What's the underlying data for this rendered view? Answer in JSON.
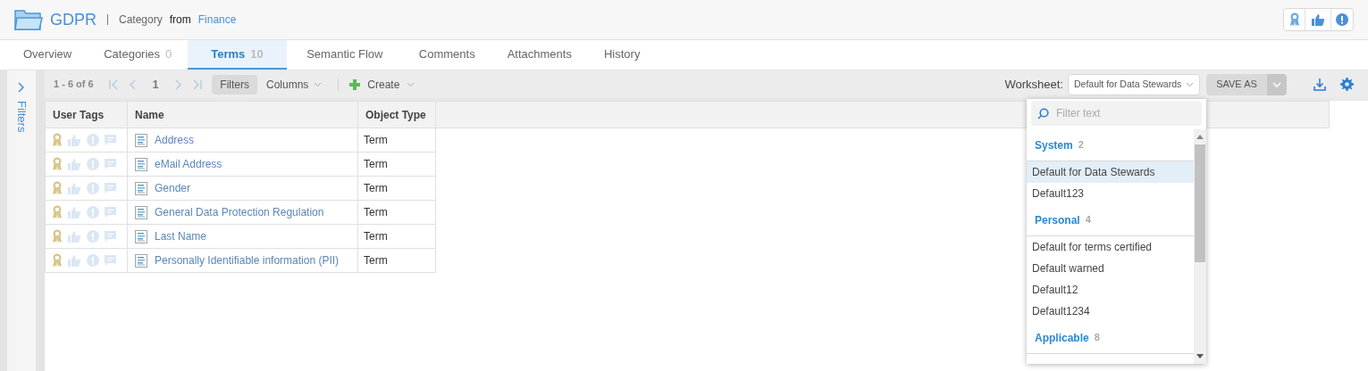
{
  "header": {
    "title": "GDPR",
    "type": "Category",
    "from": "from",
    "parent": "Finance"
  },
  "tabs": [
    {
      "label": "Overview",
      "selected": false
    },
    {
      "label": "Categories",
      "count": "0",
      "selected": false
    },
    {
      "label": "Terms",
      "count": "10",
      "selected": true
    },
    {
      "label": "Semantic Flow",
      "selected": false
    },
    {
      "label": "Comments",
      "selected": false
    },
    {
      "label": "Attachments",
      "selected": false
    },
    {
      "label": "History",
      "selected": false
    }
  ],
  "sidebar": {
    "label": "Filters"
  },
  "toolbar": {
    "range": "1 - 6 of 6",
    "page": "1",
    "filters": "Filters",
    "columns": "Columns",
    "create": "Create",
    "worksheet_label": "Worksheet:",
    "worksheet_value": "Default for Data Stewards",
    "save_as": "SAVE AS"
  },
  "table": {
    "columns": [
      "User Tags",
      "Name",
      "Object Type"
    ],
    "rows": [
      {
        "name": "Address",
        "type": "Term"
      },
      {
        "name": "eMail Address",
        "type": "Term"
      },
      {
        "name": "Gender",
        "type": "Term"
      },
      {
        "name": "General Data Protection Regulation",
        "type": "Term"
      },
      {
        "name": "Last Name",
        "type": "Term"
      },
      {
        "name": "Personally Identifiable information (PII)",
        "type": "Term"
      }
    ]
  },
  "worksheet_menu": {
    "placeholder": "Filter text",
    "groups": [
      {
        "name": "System",
        "count": "2",
        "items": [
          {
            "label": "Default for Data Stewards",
            "selected": true
          },
          {
            "label": "Default123",
            "selected": false
          }
        ]
      },
      {
        "name": "Personal",
        "count": "4",
        "items": [
          {
            "label": "Default for terms certified",
            "selected": false
          },
          {
            "label": "Default warned",
            "selected": false
          },
          {
            "label": "Default12",
            "selected": false
          },
          {
            "label": "Default1234",
            "selected": false
          }
        ]
      },
      {
        "name": "Applicable",
        "count": "8"
      }
    ]
  }
}
